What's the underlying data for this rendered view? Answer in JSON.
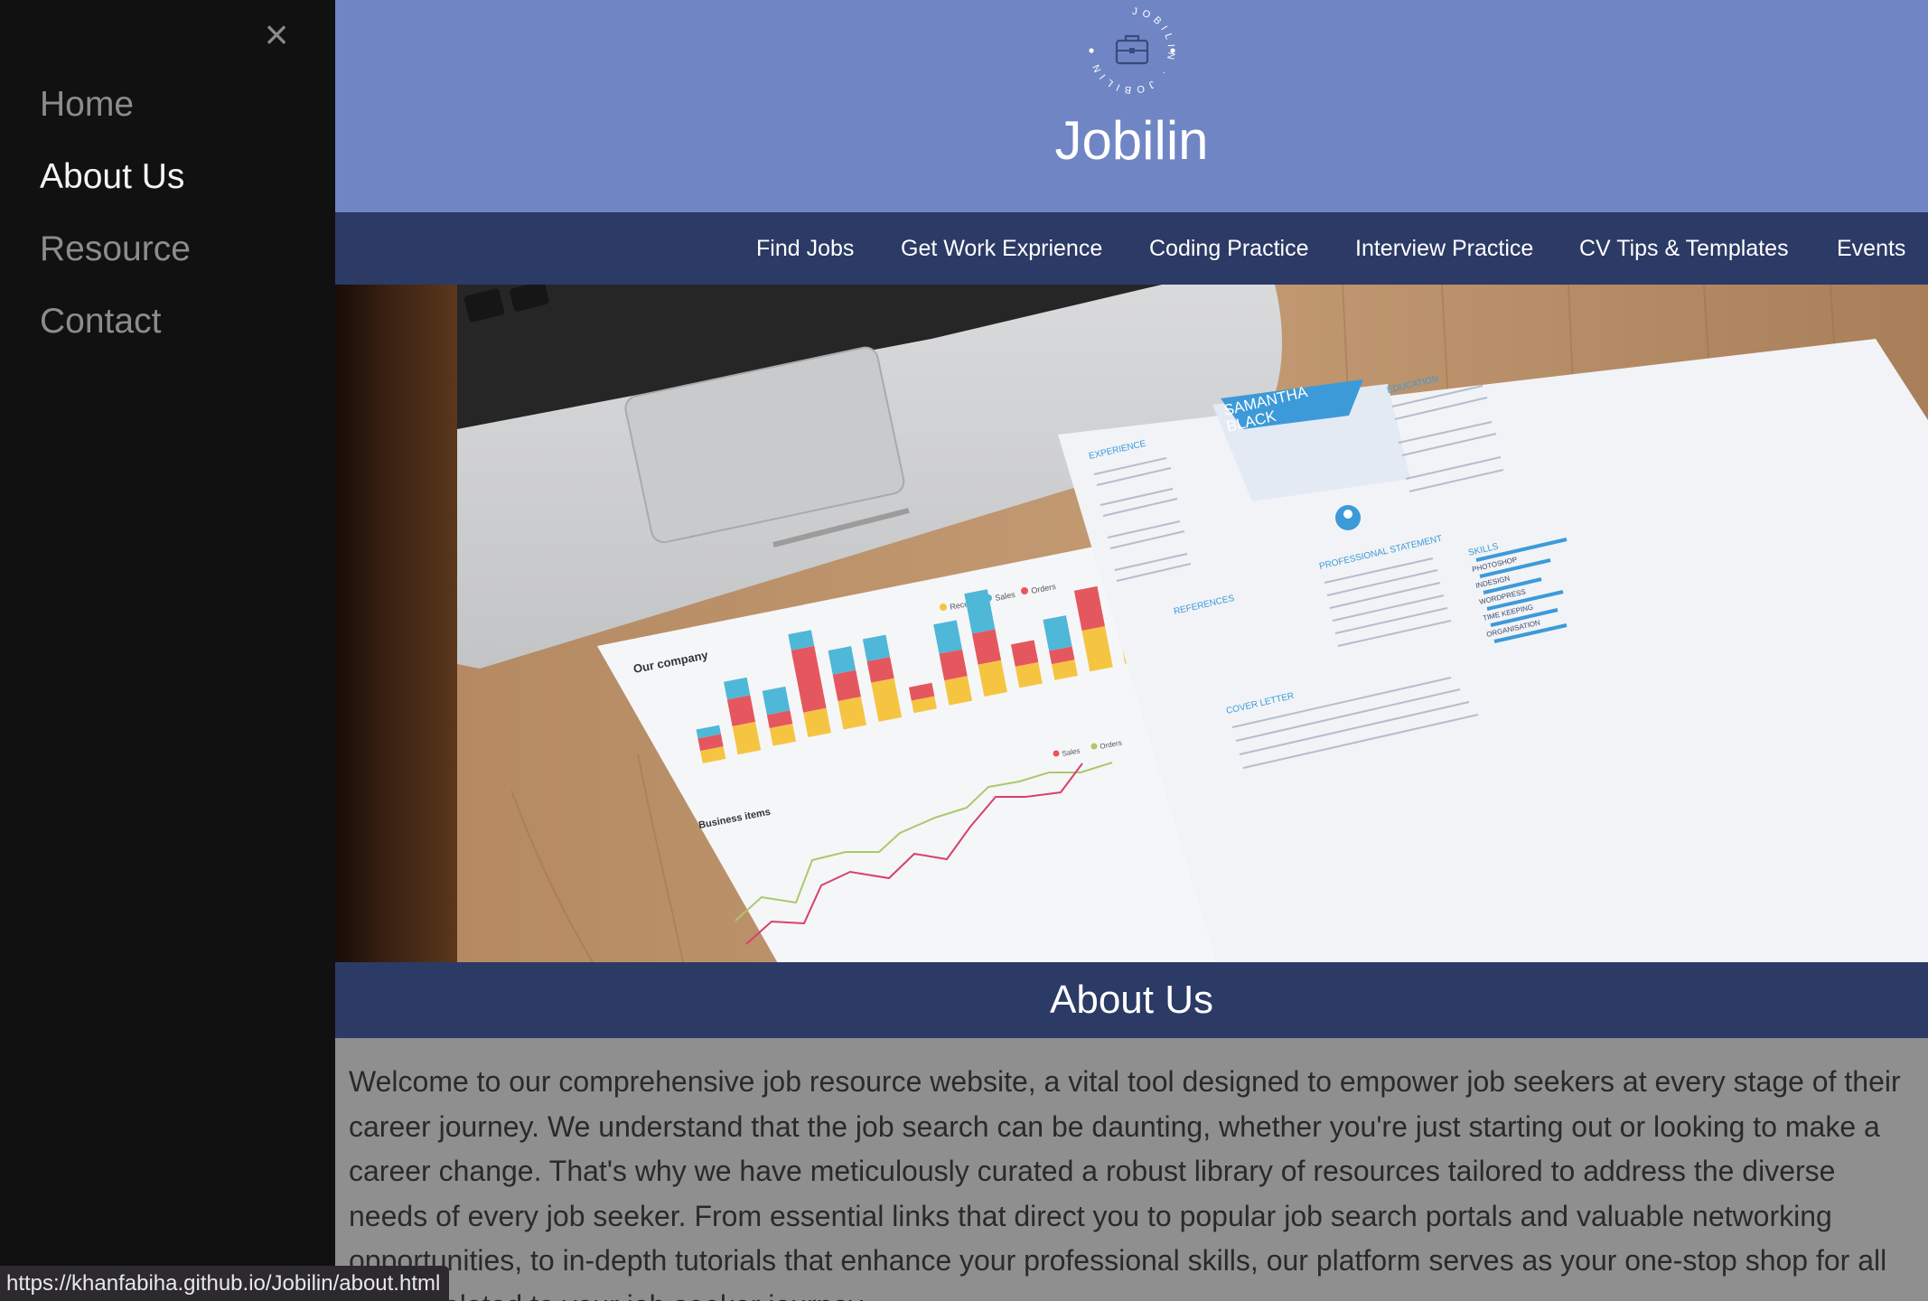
{
  "sidebar": {
    "close_glyph": "×",
    "items": [
      {
        "label": "Home",
        "active": false
      },
      {
        "label": "About Us",
        "active": true
      },
      {
        "label": "Resource",
        "active": false
      },
      {
        "label": "Contact",
        "active": false
      }
    ]
  },
  "header": {
    "logo_ring_text": "JOBILIN",
    "logo_icon": "briefcase-icon",
    "title": "Jobilin",
    "background": "#6f85c4"
  },
  "topnav": {
    "background": "#2c3a66",
    "items": [
      {
        "label": "Find Jobs"
      },
      {
        "label": "Get Work Exprience"
      },
      {
        "label": "Coding Practice"
      },
      {
        "label": "Interview Practice"
      },
      {
        "label": "CV Tips & Templates"
      },
      {
        "label": "Events"
      }
    ]
  },
  "hero": {
    "chart_heading": "Our company",
    "chart_legend": [
      "Receipts",
      "Sales",
      "Orders"
    ],
    "line_heading": "Business items",
    "line_legend": [
      "Sales",
      "Orders"
    ],
    "resume_name_line1": "SAMANTHA",
    "resume_name_line2": "BLACK",
    "resume_sections": [
      "EXPERIENCE",
      "EDUCATION",
      "SKILLS",
      "REFERENCES",
      "PROFESSIONAL STATEMENT",
      "COVER LETTER"
    ],
    "resume_skills": [
      "PHOTOSHOP",
      "INDESIGN",
      "WORDPRESS",
      "TIME KEEPING",
      "ORGANISATION"
    ]
  },
  "about": {
    "title": "About Us",
    "text": "Welcome to our comprehensive job resource website, a vital tool designed to empower job seekers at every stage of their career journey. We understand that the job search can be daunting, whether you're just starting out or looking to make a career change. That's why we have meticulously curated a robust library of resources tailored to address the diverse needs of every job seeker. From essential links that direct you to popular job search portals and valuable networking opportunities, to in-depth tutorials that enhance your professional skills, our platform serves as your one-stop shop for all things related to your job seeker journey."
  },
  "status_bar": {
    "url": "https://khanfabiha.github.io/Jobilin/about.html"
  }
}
